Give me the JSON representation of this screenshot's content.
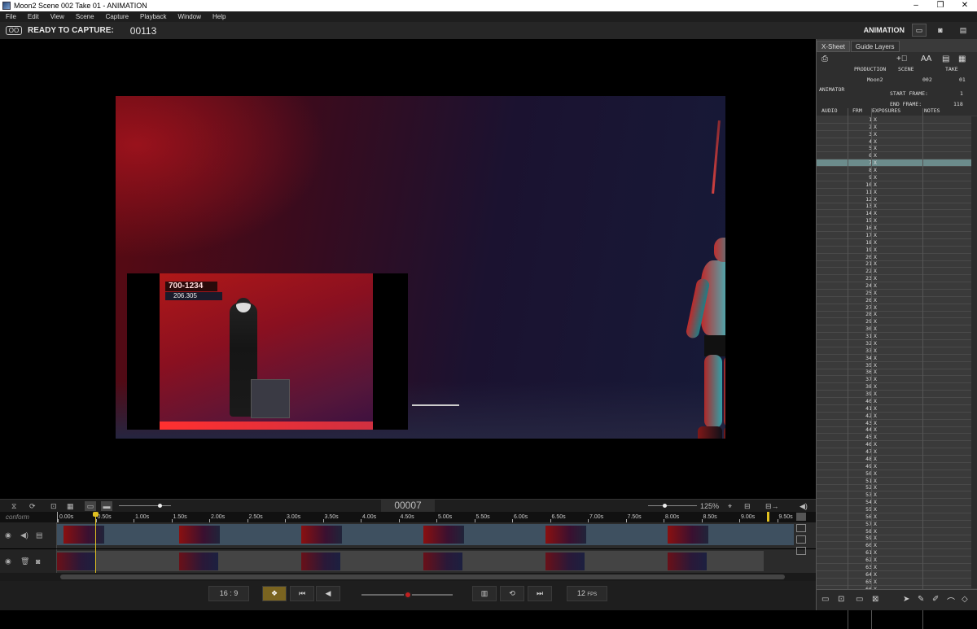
{
  "window": {
    "title": "Moon2  Scene 002  Take 01 - ANIMATION",
    "min": "–",
    "max": "❐",
    "close": "✕"
  },
  "menu": [
    "File",
    "Edit",
    "View",
    "Scene",
    "Capture",
    "Playback",
    "Window",
    "Help"
  ],
  "capture": {
    "icon": "OO",
    "status": "READY TO CAPTURE:",
    "frame": "00113",
    "mode": "ANIMATION"
  },
  "pip": {
    "tag1": "700-1234",
    "tag2": "206.305"
  },
  "viewer_toolbar": {
    "frame_counter": "00007",
    "zoom": "125%"
  },
  "timeline": {
    "conform_label": "conform",
    "ticks": [
      "0.00s",
      "0.50s",
      "1.00s",
      "1.50s",
      "2.00s",
      "2.50s",
      "3.00s",
      "3.50s",
      "4.00s",
      "4.50s",
      "5.00s",
      "5.50s",
      "6.00s",
      "6.50s",
      "7.00s",
      "7.50s",
      "8.00s",
      "8.50s",
      "9.00s",
      "9.50s"
    ]
  },
  "bottom": {
    "aspect": "16 : 9",
    "fps_value": "12",
    "fps_unit": "FPS"
  },
  "xsheet": {
    "tabs": [
      "X-Sheet",
      "Guide Layers"
    ],
    "production_label": "PRODUCTION",
    "scene_label": "SCENE",
    "take_label": "TAKE",
    "production": "Moon2",
    "scene": "002",
    "take": "01",
    "animator_label": "ANIMATOR",
    "start_frame_label": "START FRAME:",
    "start_frame": "1",
    "end_frame_label": "END FRAME:",
    "end_frame": "118",
    "col_audio": "AUDIO",
    "col_frm": "FRM",
    "col_exposures": "EXPOSURES",
    "col_notes": "NOTES",
    "selected_frame": 7,
    "mark": "X"
  },
  "colors": {
    "accent": "#e0c020",
    "selected_row": "#6c8c8c"
  }
}
